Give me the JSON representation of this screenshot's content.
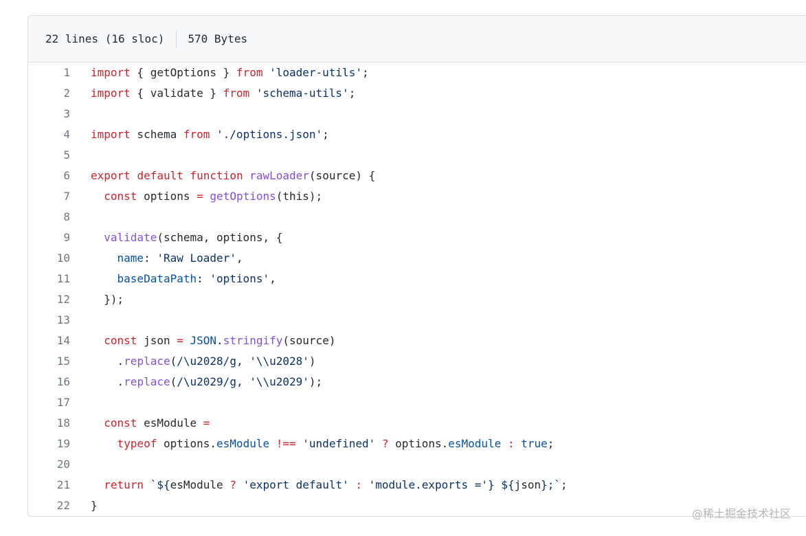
{
  "file_info": {
    "lines": "22 lines (16 sloc)",
    "size": "570 Bytes"
  },
  "colors": {
    "keyword": "#cf222e",
    "function": "#8250df",
    "string": "#0a3069",
    "constant": "#0550ae",
    "line_number": "#6e7781"
  },
  "code_lines": [
    {
      "num": "1",
      "tokens": [
        {
          "t": "import",
          "c": "k"
        },
        {
          "t": " { getOptions } "
        },
        {
          "t": "from",
          "c": "k"
        },
        {
          "t": " "
        },
        {
          "t": "'loader-utils'",
          "c": "s"
        },
        {
          "t": ";"
        }
      ]
    },
    {
      "num": "2",
      "tokens": [
        {
          "t": "import",
          "c": "k"
        },
        {
          "t": " { validate } "
        },
        {
          "t": "from",
          "c": "k"
        },
        {
          "t": " "
        },
        {
          "t": "'schema-utils'",
          "c": "s"
        },
        {
          "t": ";"
        }
      ]
    },
    {
      "num": "3",
      "tokens": []
    },
    {
      "num": "4",
      "tokens": [
        {
          "t": "import",
          "c": "k"
        },
        {
          "t": " schema "
        },
        {
          "t": "from",
          "c": "k"
        },
        {
          "t": " "
        },
        {
          "t": "'./options.json'",
          "c": "s"
        },
        {
          "t": ";"
        }
      ]
    },
    {
      "num": "5",
      "tokens": []
    },
    {
      "num": "6",
      "tokens": [
        {
          "t": "export",
          "c": "k"
        },
        {
          "t": " "
        },
        {
          "t": "default",
          "c": "k"
        },
        {
          "t": " "
        },
        {
          "t": "function",
          "c": "k"
        },
        {
          "t": " "
        },
        {
          "t": "rawLoader",
          "c": "f"
        },
        {
          "t": "(source) {"
        }
      ]
    },
    {
      "num": "7",
      "tokens": [
        {
          "t": "  "
        },
        {
          "t": "const",
          "c": "k"
        },
        {
          "t": " options "
        },
        {
          "t": "=",
          "c": "k"
        },
        {
          "t": " "
        },
        {
          "t": "getOptions",
          "c": "f"
        },
        {
          "t": "(this);"
        }
      ]
    },
    {
      "num": "8",
      "tokens": []
    },
    {
      "num": "9",
      "tokens": [
        {
          "t": "  "
        },
        {
          "t": "validate",
          "c": "f"
        },
        {
          "t": "(schema, options, {"
        }
      ]
    },
    {
      "num": "10",
      "tokens": [
        {
          "t": "    "
        },
        {
          "t": "name",
          "c": "c"
        },
        {
          "t": ": "
        },
        {
          "t": "'Raw Loader'",
          "c": "s"
        },
        {
          "t": ","
        }
      ]
    },
    {
      "num": "11",
      "tokens": [
        {
          "t": "    "
        },
        {
          "t": "baseDataPath",
          "c": "c"
        },
        {
          "t": ": "
        },
        {
          "t": "'options'",
          "c": "s"
        },
        {
          "t": ","
        }
      ]
    },
    {
      "num": "12",
      "tokens": [
        {
          "t": "  });"
        }
      ]
    },
    {
      "num": "13",
      "tokens": []
    },
    {
      "num": "14",
      "tokens": [
        {
          "t": "  "
        },
        {
          "t": "const",
          "c": "k"
        },
        {
          "t": " json "
        },
        {
          "t": "=",
          "c": "k"
        },
        {
          "t": " "
        },
        {
          "t": "JSON",
          "c": "c"
        },
        {
          "t": "."
        },
        {
          "t": "stringify",
          "c": "f"
        },
        {
          "t": "(source)"
        }
      ]
    },
    {
      "num": "15",
      "tokens": [
        {
          "t": "    ."
        },
        {
          "t": "replace",
          "c": "f"
        },
        {
          "t": "("
        },
        {
          "t": "/\\u2028/g",
          "c": "s"
        },
        {
          "t": ", "
        },
        {
          "t": "'\\\\u2028'",
          "c": "s"
        },
        {
          "t": ")"
        }
      ]
    },
    {
      "num": "16",
      "tokens": [
        {
          "t": "    ."
        },
        {
          "t": "replace",
          "c": "f"
        },
        {
          "t": "("
        },
        {
          "t": "/\\u2029/g",
          "c": "s"
        },
        {
          "t": ", "
        },
        {
          "t": "'\\\\u2029'",
          "c": "s"
        },
        {
          "t": ");"
        }
      ]
    },
    {
      "num": "17",
      "tokens": []
    },
    {
      "num": "18",
      "tokens": [
        {
          "t": "  "
        },
        {
          "t": "const",
          "c": "k"
        },
        {
          "t": " esModule "
        },
        {
          "t": "=",
          "c": "k"
        }
      ]
    },
    {
      "num": "19",
      "tokens": [
        {
          "t": "    "
        },
        {
          "t": "typeof",
          "c": "k"
        },
        {
          "t": " options."
        },
        {
          "t": "esModule",
          "c": "c"
        },
        {
          "t": " "
        },
        {
          "t": "!==",
          "c": "k"
        },
        {
          "t": " "
        },
        {
          "t": "'undefined'",
          "c": "s"
        },
        {
          "t": " "
        },
        {
          "t": "?",
          "c": "k"
        },
        {
          "t": " options."
        },
        {
          "t": "esModule",
          "c": "c"
        },
        {
          "t": " "
        },
        {
          "t": ":",
          "c": "k"
        },
        {
          "t": " "
        },
        {
          "t": "true",
          "c": "c"
        },
        {
          "t": ";"
        }
      ]
    },
    {
      "num": "20",
      "tokens": []
    },
    {
      "num": "21",
      "tokens": [
        {
          "t": "  "
        },
        {
          "t": "return",
          "c": "k"
        },
        {
          "t": " "
        },
        {
          "t": "`${",
          "c": "s"
        },
        {
          "t": "esModule "
        },
        {
          "t": "?",
          "c": "k"
        },
        {
          "t": " "
        },
        {
          "t": "'export default'",
          "c": "s"
        },
        {
          "t": " "
        },
        {
          "t": ":",
          "c": "k"
        },
        {
          "t": " "
        },
        {
          "t": "'module.exports ='",
          "c": "s"
        },
        {
          "t": "}",
          "c": "s"
        },
        {
          "t": " "
        },
        {
          "t": "${",
          "c": "s"
        },
        {
          "t": "json"
        },
        {
          "t": "};`",
          "c": "s"
        },
        {
          "t": ";"
        }
      ]
    },
    {
      "num": "22",
      "tokens": [
        {
          "t": "}"
        }
      ]
    }
  ],
  "watermark": "@稀土掘金技术社区"
}
